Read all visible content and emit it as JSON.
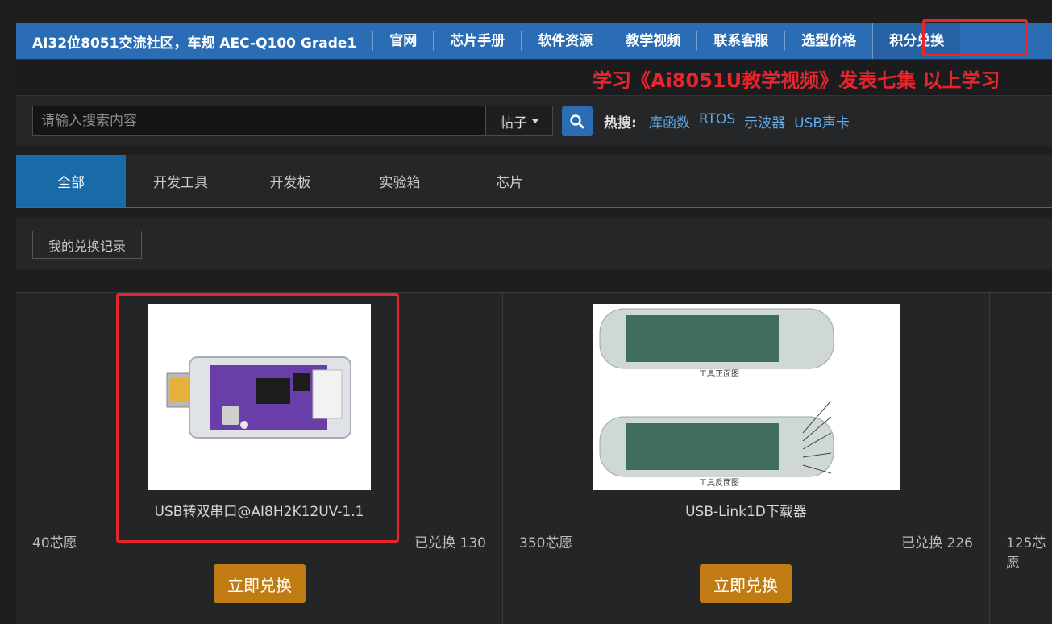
{
  "topnav": {
    "brand": "AI32位8051交流社区，车规 AEC-Q100 Grade1",
    "items": [
      {
        "label": "官网"
      },
      {
        "label": "芯片手册"
      },
      {
        "label": "软件资源"
      },
      {
        "label": "教学视频"
      },
      {
        "label": "联系客服"
      },
      {
        "label": "选型价格"
      },
      {
        "label": "积分兑换"
      }
    ]
  },
  "marquee": {
    "text": "学习《Ai8051U教学视频》发表七集 以上学习"
  },
  "search": {
    "placeholder": "请输入搜索内容",
    "type_label": "帖子",
    "hot_label": "热搜:",
    "hot_links": [
      "库函数",
      "RTOS",
      "示波器",
      "USB声卡"
    ]
  },
  "tabs": [
    "全部",
    "开发工具",
    "开发板",
    "实验箱",
    "芯片"
  ],
  "records_label": "我的兑换记录",
  "products": [
    {
      "name": "USB转双串口@AI8H2K12UV-1.1",
      "price": "40芯愿",
      "sold": "已兑换 130",
      "button": "立即兑换",
      "image_caption_top": "",
      "image_caption_bottom": ""
    },
    {
      "name": "USB-Link1D下载器",
      "price": "350芯愿",
      "sold": "已兑换 226",
      "button": "立即兑换",
      "image_caption_top": "工具正面图",
      "image_caption_bottom": "工具反面图"
    },
    {
      "price": "125芯愿"
    }
  ],
  "colors": {
    "nav_blue": "#2a6db4",
    "highlight_red": "#e8242c",
    "redeem_orange": "#c07b12",
    "link_blue": "#5fa8e8"
  }
}
